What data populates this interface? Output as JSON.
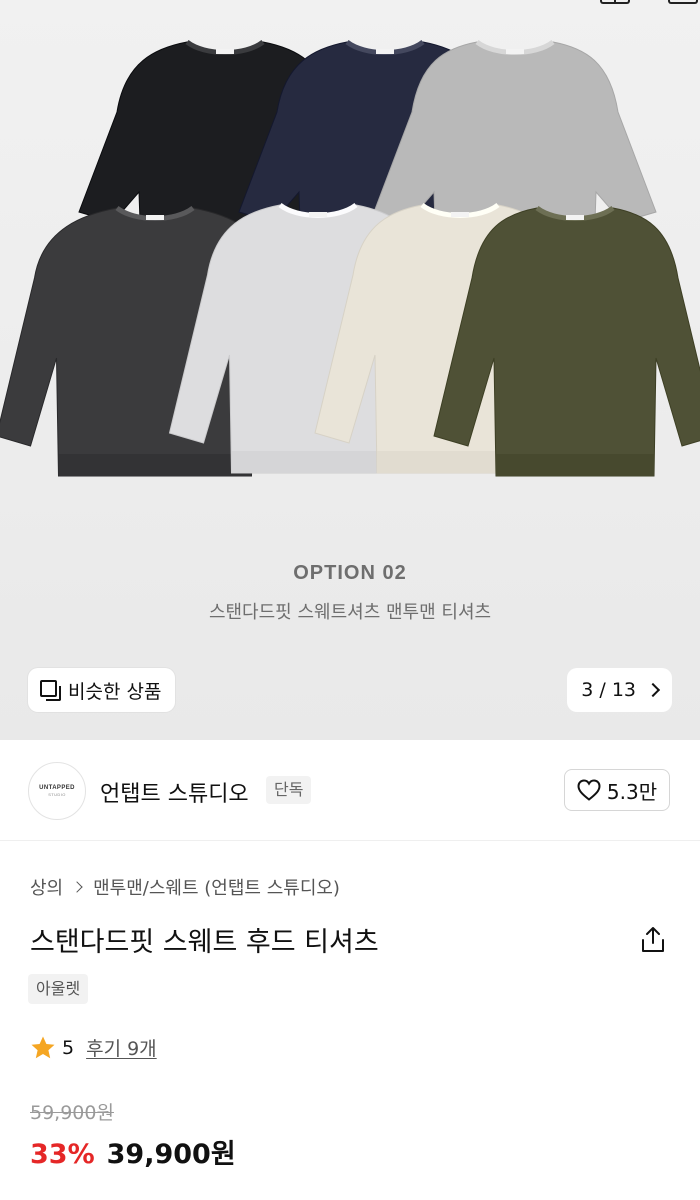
{
  "hero": {
    "option_title": "OPTION 02",
    "option_subtitle": "스탠다드핏 스웨트셔츠 맨투맨 티셔츠",
    "similar_button_label": "비슷한 상품",
    "pager_label": "3 / 13",
    "sweater_colors": [
      "#1c1d20",
      "#262a40",
      "#b9b9b9",
      "#3b3b3d",
      "#dddddf",
      "#e9e4d8",
      "#4f5136"
    ],
    "sweater_labels": [
      "black",
      "navy",
      "melange-gray",
      "charcoal",
      "white-melange",
      "cream",
      "khaki"
    ]
  },
  "brand": {
    "logo_text": "UNTAPPED",
    "logo_subtext": "STUDIO",
    "name": "언탭트 스튜디오",
    "tag": "단독",
    "likes": "5.3만"
  },
  "product": {
    "breadcrumb": [
      "상의",
      "맨투맨/스웨트 (언탭트 스튜디오)"
    ],
    "title": "스탠다드핏 스웨트 후드 티셔츠",
    "tag": "아울렛",
    "rating": "5",
    "review_label": "후기 9개",
    "original_price": "59,900원",
    "discount": "33%",
    "sale_price": "39,900원"
  },
  "colors": {
    "accent_red": "#e52727",
    "star": "#f5a623"
  }
}
